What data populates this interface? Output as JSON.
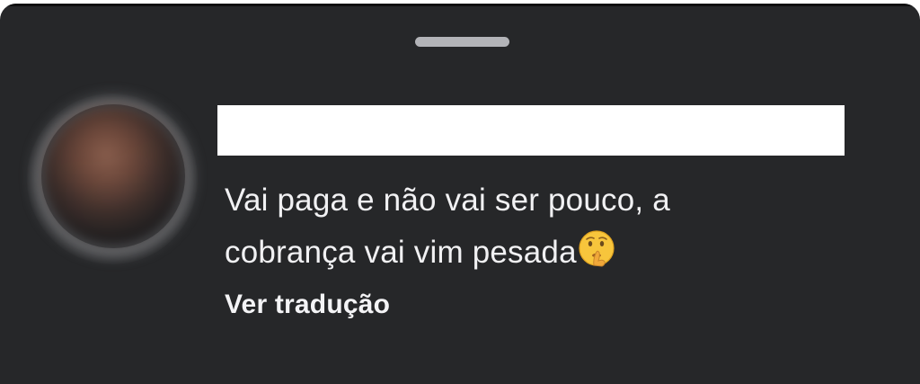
{
  "comment": {
    "lines": [
      "Vai paga e não vai ser pouco, a",
      "cobrança vai vim pesada"
    ],
    "emoji": "shushing-face-emoji"
  },
  "actions": {
    "translate_label": "Ver tradução"
  },
  "colors": {
    "background": "#262729",
    "text": "#f1f1f3",
    "handle": "#b3b4b8",
    "redaction": "#ffffff"
  }
}
